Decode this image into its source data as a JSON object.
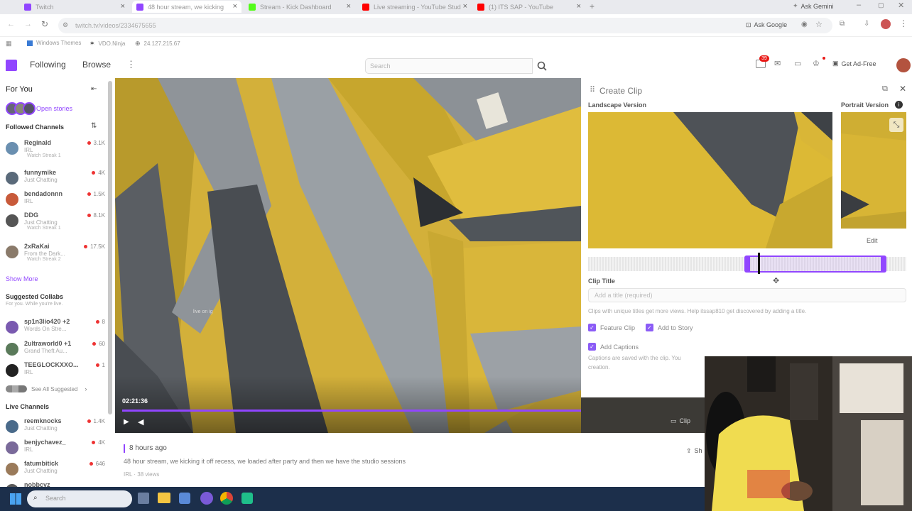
{
  "tabs": [
    {
      "label": "Twitch",
      "color": "#9146ff"
    },
    {
      "label": "48 hour stream, we kicking",
      "color": "#9146ff"
    },
    {
      "label": "Stream - Kick Dashboard",
      "color": "#53fc18"
    },
    {
      "label": "Live streaming - YouTube Stud",
      "color": "#ff0000"
    },
    {
      "label": "(1) ITS SAP - YouTube",
      "color": "#ff0000"
    }
  ],
  "browser": {
    "url": "twitch.tv/videos/2334675655",
    "ask_gemini": "Ask Gemini",
    "ask_google": "Ask Google",
    "bookmarks": [
      "Windows Themes",
      "VDO.Ninja",
      "24.127.215.67"
    ]
  },
  "nav": {
    "following": "Following",
    "browse": "Browse",
    "search_placeholder": "Search",
    "notif_count": "39",
    "get_ad_free": "Get Ad-Free"
  },
  "sidebar": {
    "for_you": "For You",
    "open_stories": "Open stories",
    "followed_channels": "Followed Channels",
    "followed": [
      {
        "name": "Reginald",
        "game": "IRL",
        "viewers": "3.1K",
        "streak": "Watch Streak 1",
        "color": "#6a8fb0"
      },
      {
        "name": "funnymike",
        "game": "Just Chatting",
        "viewers": "4K",
        "streak": "",
        "color": "#5a6a7a"
      },
      {
        "name": "bendadonnn",
        "game": "IRL",
        "viewers": "1.5K",
        "streak": "",
        "color": "#c85a3a"
      },
      {
        "name": "DDG",
        "game": "Just Chatting",
        "viewers": "8.1K",
        "streak": "Watch Streak 1",
        "color": "#555"
      },
      {
        "name": "2xRaKai",
        "game": "From the Dark...",
        "viewers": "17.5K",
        "streak": "Watch Streak 2",
        "color": "#8a7a6a"
      }
    ],
    "show_more": "Show More",
    "suggested_collabs": "Suggested Collabs",
    "collabs_sub": "For you. While you're live.",
    "collabs": [
      {
        "name": "sp1n3lio420 +2",
        "game": "Words On Stre...",
        "viewers": "8",
        "color": "#7a5ab0"
      },
      {
        "name": "2ultraworld0 +1",
        "game": "Grand Theft Au...",
        "viewers": "60",
        "color": "#5a7a5a"
      },
      {
        "name": "TEEGLOCKXXO...",
        "game": "IRL",
        "viewers": "1",
        "color": "#222"
      }
    ],
    "see_all": "See All Suggested",
    "live_channels": "Live Channels",
    "live": [
      {
        "name": "reemknocks",
        "game": "Just Chatting",
        "viewers": "1.4K",
        "color": "#4a6a8a"
      },
      {
        "name": "benjychavez_",
        "game": "IRL",
        "viewers": "4K",
        "color": "#7a6a9a"
      },
      {
        "name": "fatumbitick",
        "game": "Just Chatting",
        "viewers": "646",
        "color": "#9a7a5a"
      },
      {
        "name": "nobbcyz",
        "game": "",
        "viewers": "",
        "color": "#5a5a5a"
      }
    ]
  },
  "player": {
    "timestamp": "02:21:36",
    "progress": 0.87,
    "clip_label": "Clip",
    "overlay_text": "live on ig"
  },
  "clip_panel": {
    "title": "Create Clip",
    "landscape_label": "Landscape Version",
    "portrait_label": "Portrait Version",
    "edit_label": "Edit",
    "clip_title_label": "Clip Title",
    "title_placeholder": "Add a title (required)",
    "helper": "Clips with unique titles get more views. Help itssap810 get discovered by adding a title.",
    "feature_clip": "Feature Clip",
    "add_to_story": "Add to Story",
    "add_captions": "Add Captions",
    "captions_help": "Captions are saved with the clip. You",
    "captions_help2": "creation."
  },
  "video_info": {
    "ago": "8 hours ago",
    "title": "48 hour stream, we kicking it off recess, we loaded after party and then we have the studio sessions",
    "meta": "IRL · 38 views",
    "share": "Sh"
  },
  "taskbar": {
    "search_placeholder": "Search"
  }
}
